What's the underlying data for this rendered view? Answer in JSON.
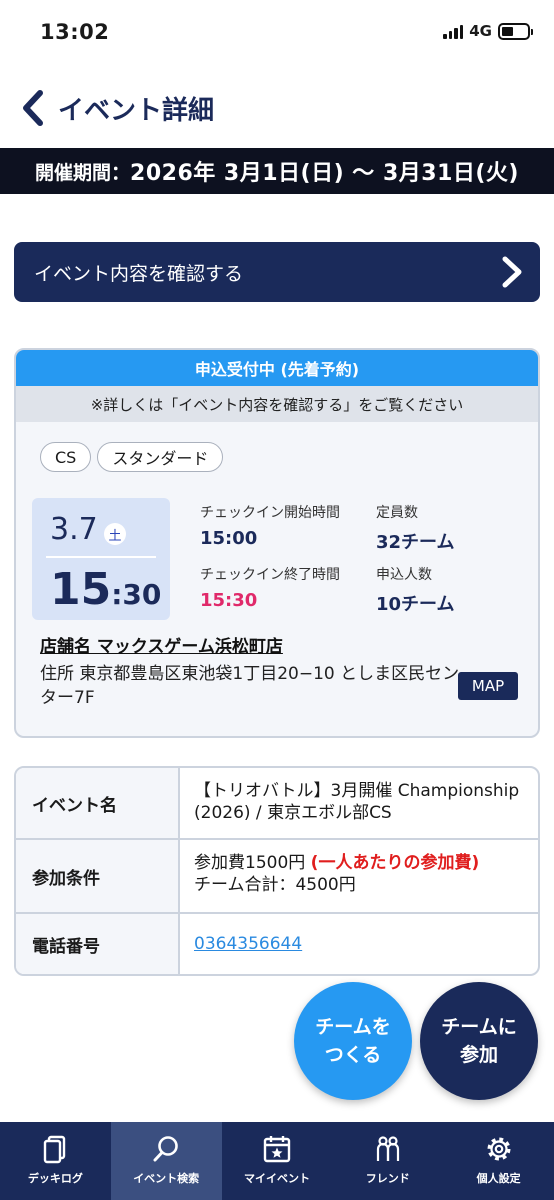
{
  "status_bar": {
    "time": "13:02",
    "network": "4G"
  },
  "header": {
    "title": "イベント詳細"
  },
  "period": {
    "label": "開催期間：",
    "value": "2026年 3月1日(日) ～ 3月31日(火)"
  },
  "confirm_button": {
    "label": "イベント内容を確認する"
  },
  "event_card": {
    "status": "申込受付中 (先着予約)",
    "note": "※詳しくは「イベント内容を確認する」をご覧ください",
    "tags": [
      "CS",
      "スタンダード"
    ],
    "date": {
      "month_day": "3.7",
      "weekday": "土",
      "hour": "15",
      "minute": ":30"
    },
    "checkin_start_label": "チェックイン開始時間",
    "checkin_start": "15:00",
    "checkin_end_label": "チェックイン終了時間",
    "checkin_end": "15:30",
    "capacity_label": "定員数",
    "capacity": "32チーム",
    "applicants_label": "申込人数",
    "applicants": "10チーム",
    "shop": "店舗名 マックスゲーム浜松町店",
    "address": "住所 東京都豊島区東池袋1丁目20−10 としま区民センター7F",
    "map_label": "MAP"
  },
  "details": {
    "event_name_label": "イベント名",
    "event_name": "【トリオバトル】3月開催 Championship (2026) / 東京エボル部CS",
    "conditions_label": "参加条件",
    "fee": "参加費1500円",
    "fee_note": "(一人あたりの参加費)",
    "team_total": "チーム合計：4500円",
    "phone_label": "電話番号",
    "phone": "0364356644"
  },
  "fab": {
    "create_line1": "チームを",
    "create_line2": "つくる",
    "join_line1": "チームに",
    "join_line2": "参加"
  },
  "tabbar": {
    "items": [
      {
        "label": "デッキログ",
        "icon": "deck-icon"
      },
      {
        "label": "イベント検索",
        "icon": "search-icon"
      },
      {
        "label": "マイイベント",
        "icon": "calendar-star-icon"
      },
      {
        "label": "フレンド",
        "icon": "friends-icon"
      },
      {
        "label": "個人設定",
        "icon": "gear-icon"
      }
    ],
    "active_index": 1
  },
  "colors": {
    "navy": "#1a2a5a",
    "accent_blue": "#2699f2",
    "pink": "#e0296a",
    "red": "#e01e1e"
  }
}
